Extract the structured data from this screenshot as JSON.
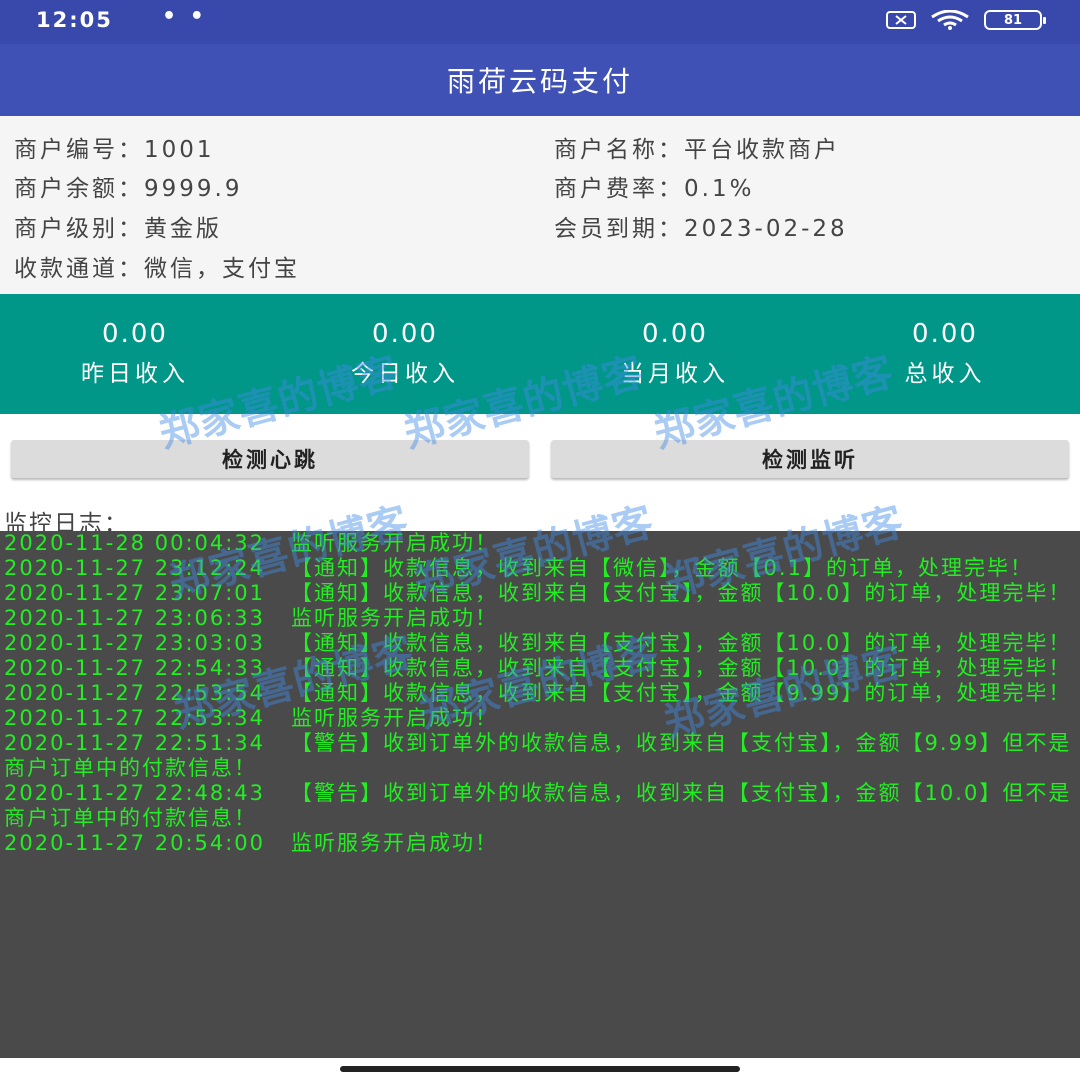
{
  "status_bar": {
    "time": "12:05",
    "dots": "• •",
    "battery": "81"
  },
  "app_bar": {
    "title": "雨荷云码支付"
  },
  "merchant": {
    "id": "商户编号：1001",
    "name": "商户名称：平台收款商户",
    "balance": "商户余额：9999.9",
    "rate": "商户费率：0.1%",
    "level": "商户级别：黄金版",
    "expiry": "会员到期：2023-02-28",
    "channels": "收款通道：微信，支付宝"
  },
  "stats": [
    {
      "value": "0.00",
      "label": "昨日收入"
    },
    {
      "value": "0.00",
      "label": "今日收入"
    },
    {
      "value": "0.00",
      "label": "当月收入"
    },
    {
      "value": "0.00",
      "label": "总收入"
    }
  ],
  "buttons": {
    "heartbeat": "检测心跳",
    "listener": "检测监听"
  },
  "log": {
    "title": "监控日志：",
    "entries": [
      "2020-11-28 00:04:32   监听服务开启成功！",
      "2020-11-27 23:12:24   【通知】收款信息，收到来自【微信】，金额【0.1】的订单，处理完毕！",
      "2020-11-27 23:07:01   【通知】收款信息，收到来自【支付宝】，金额【10.0】的订单，处理完毕！",
      "2020-11-27 23:06:33   监听服务开启成功！",
      "2020-11-27 23:03:03   【通知】收款信息，收到来自【支付宝】，金额【10.0】的订单，处理完毕！",
      "2020-11-27 22:54:33   【通知】收款信息，收到来自【支付宝】，金额【10.0】的订单，处理完毕！",
      "2020-11-27 22:53:54   【通知】收款信息，收到来自【支付宝】，金额【9.99】的订单，处理完毕！",
      "2020-11-27 22:53:34   监听服务开启成功！",
      "2020-11-27 22:51:34   【警告】收到订单外的收款信息，收到来自【支付宝】，金额【9.99】但不是商户订单中的付款信息！",
      "2020-11-27 22:48:43   【警告】收到订单外的收款信息，收到来自【支付宝】，金额【10.0】但不是商户订单中的付款信息！",
      "2020-11-27 20:54:00   监听服务开启成功！"
    ]
  },
  "watermark": {
    "text": "郑家喜的博客"
  },
  "colors": {
    "status_bar": "#3949ab",
    "app_bar": "#3f51b5",
    "stats_panel": "#009688",
    "log_background": "#4a4a4a",
    "log_text": "#22ee22"
  }
}
